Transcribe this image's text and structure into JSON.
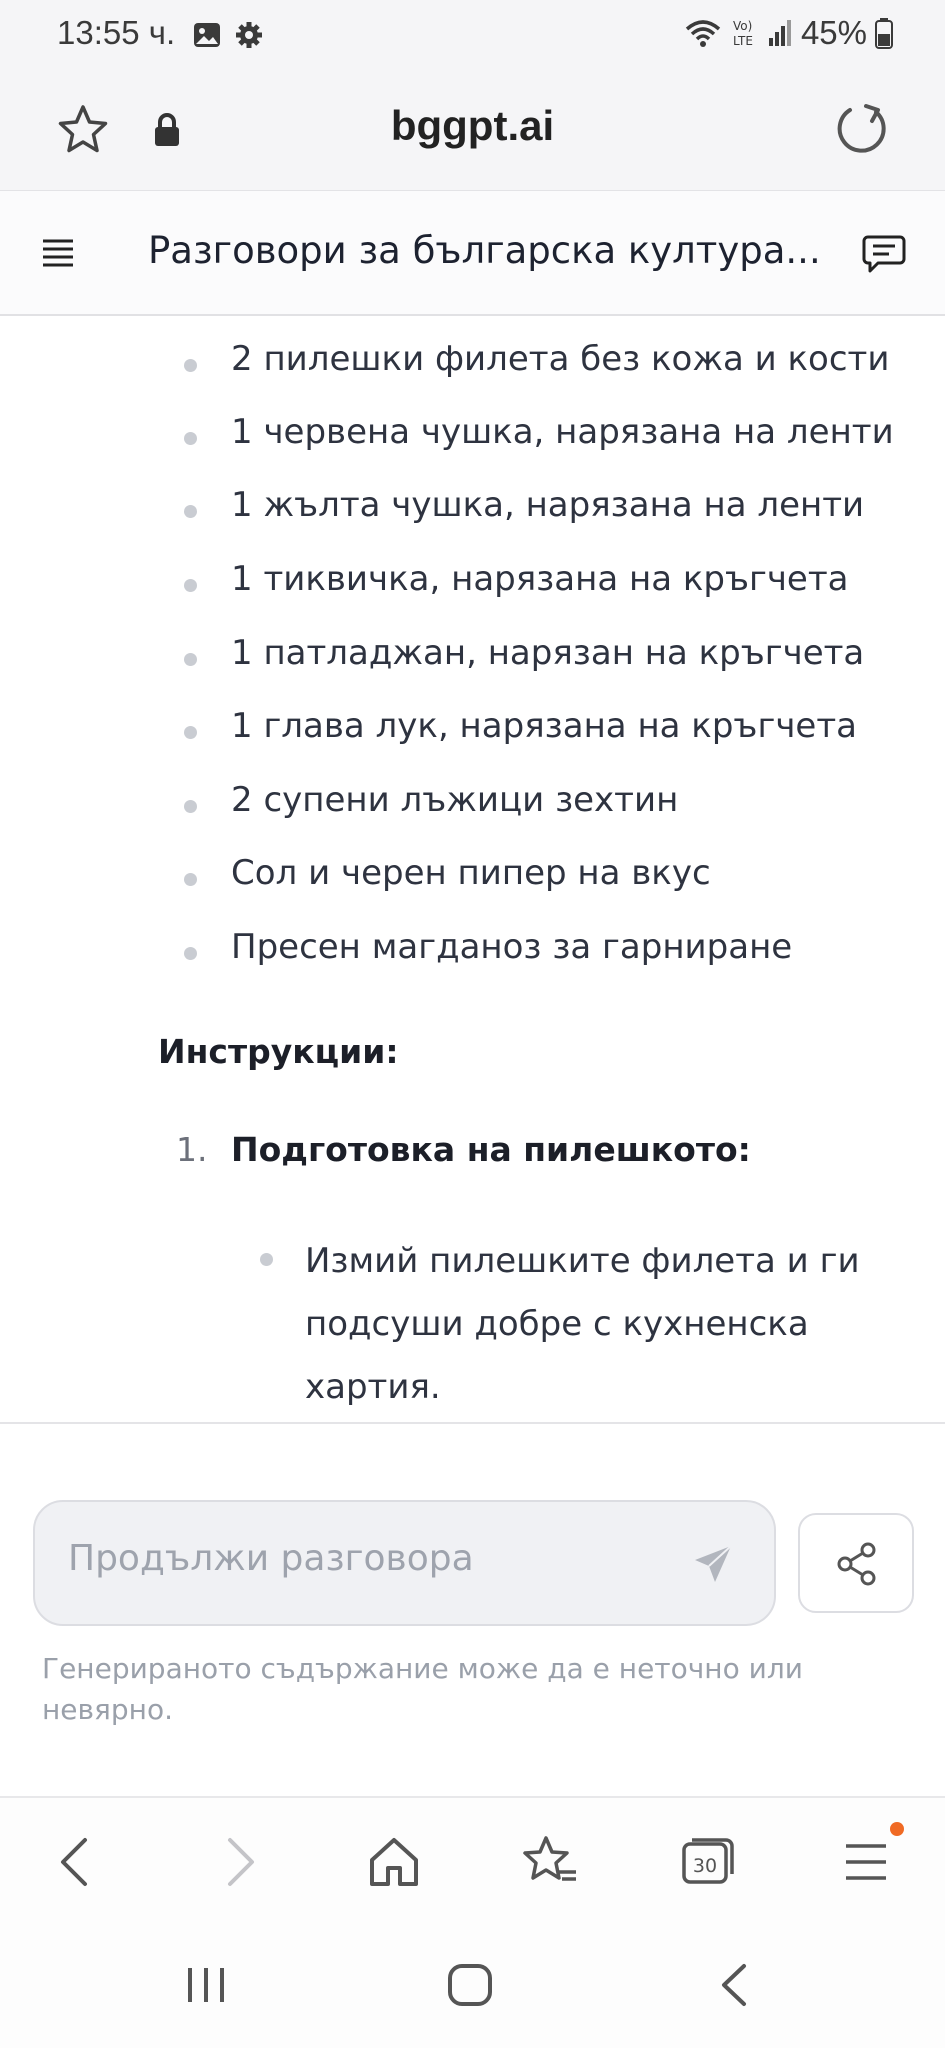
{
  "status_bar": {
    "time": "13:55 ч.",
    "battery": "45%",
    "network_label": "Vo) LTE"
  },
  "browser": {
    "url": "bggpt.ai"
  },
  "app": {
    "title": "Разговори за българска култура..."
  },
  "content": {
    "ingredients": [
      "2 пилешки филета без кожа и кости",
      "1 червена чушка, нарязана на ленти",
      "1 жълта чушка, нарязана на ленти",
      "1 тиквичка, нарязана на кръгчета",
      "1 патладжан, нарязан на кръгчета",
      "1 глава лук, нарязана на кръгчета",
      "2 супени лъжици зехтин",
      "Сол и черен пипер на вкус",
      "Пресен магданоз за гарниране"
    ],
    "instructions_heading": "Инструкции:",
    "step_number": "1.",
    "step_title": "Подготовка на пилешкото:",
    "step_detail": "Измий пилешките филета и ги подсуши добре с кухненска хартия."
  },
  "input": {
    "placeholder": "Продължи разговора"
  },
  "disclaimer": "Генерираното съдържание може да е неточно или невярно.",
  "bottom_nav": {
    "tabs_count": "30"
  },
  "colors": {
    "accent_dot": "#f06a24",
    "text": "#2e3340",
    "muted": "#9aa0aa"
  }
}
